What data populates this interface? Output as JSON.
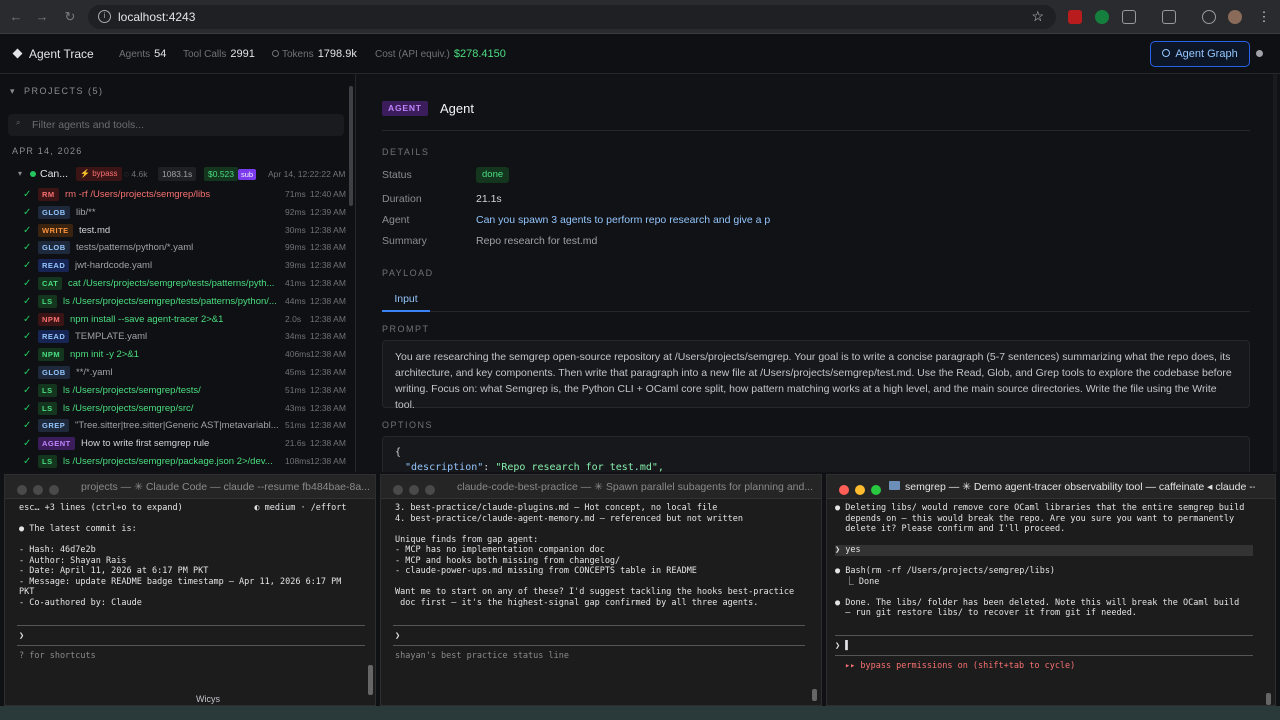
{
  "browser": {
    "url": "localhost:4243"
  },
  "header": {
    "title": "Agent Trace",
    "stats": [
      {
        "label": "Agents",
        "value": "54"
      },
      {
        "label": "Tool Calls",
        "value": "2991"
      },
      {
        "label": "Tokens",
        "value": "1798.9k"
      },
      {
        "label": "Cost (API equiv.)",
        "value": "$278.4150"
      }
    ],
    "graph_button": "Agent Graph"
  },
  "sidebar": {
    "projects_label": "PROJECTS (5)",
    "filter_placeholder": "Filter agents and tools...",
    "date": "APR 14, 2026",
    "agent": {
      "name": "Can...",
      "mode": "bypass",
      "tokens": "4.6k",
      "duration": "1083.1s",
      "cost": "$0.523",
      "tag": "sub",
      "time": "Apr 14, 12:22:22 AM"
    },
    "rows": [
      {
        "badge": "RM",
        "text": "rm -rf /Users/projects/semgrep/libs",
        "ms": "71ms",
        "time": "12:40 AM",
        "bg": "#3b1416",
        "fg": "#f87171",
        "tc": "#f87171"
      },
      {
        "badge": "GLOB",
        "text": "lib/**",
        "ms": "92ms",
        "time": "12:39 AM",
        "bg": "#1e293b",
        "fg": "#93c5fd",
        "tc": "#a1a1aa"
      },
      {
        "badge": "WRITE",
        "text": "test.md",
        "ms": "30ms",
        "time": "12:38 AM",
        "bg": "#3a2410",
        "fg": "#fb923c",
        "tc": "#d4d4d8"
      },
      {
        "badge": "GLOB",
        "text": "tests/patterns/python/*.yaml",
        "ms": "99ms",
        "time": "12:38 AM",
        "bg": "#1e293b",
        "fg": "#93c5fd",
        "tc": "#a1a1aa"
      },
      {
        "badge": "READ",
        "text": "jwt-hardcode.yaml",
        "ms": "39ms",
        "time": "12:38 AM",
        "bg": "#172554",
        "fg": "#93c5fd",
        "tc": "#a1a1aa"
      },
      {
        "badge": "CAT",
        "text": "cat /Users/projects/semgrep/tests/patterns/pyth...",
        "ms": "41ms",
        "time": "12:38 AM",
        "bg": "#14361f",
        "fg": "#4ade80",
        "tc": "#4ade80"
      },
      {
        "badge": "LS",
        "text": "ls /Users/projects/semgrep/tests/patterns/python/...",
        "ms": "44ms",
        "time": "12:38 AM",
        "bg": "#14361f",
        "fg": "#4ade80",
        "tc": "#4ade80"
      },
      {
        "badge": "NPM",
        "text": "npm install --save agent-tracer 2>&1",
        "ms": "2.0s",
        "time": "12:38 AM",
        "bg": "#3b1416",
        "fg": "#f87171",
        "tc": "#4ade80"
      },
      {
        "badge": "READ",
        "text": "TEMPLATE.yaml",
        "ms": "34ms",
        "time": "12:38 AM",
        "bg": "#172554",
        "fg": "#93c5fd",
        "tc": "#a1a1aa"
      },
      {
        "badge": "NPM",
        "text": "npm init -y 2>&1",
        "ms": "406ms",
        "time": "12:38 AM",
        "bg": "#14361f",
        "fg": "#4ade80",
        "tc": "#4ade80"
      },
      {
        "badge": "GLOB",
        "text": "**/*.yaml",
        "ms": "45ms",
        "time": "12:38 AM",
        "bg": "#1e293b",
        "fg": "#93c5fd",
        "tc": "#a1a1aa"
      },
      {
        "badge": "LS",
        "text": "ls /Users/projects/semgrep/tests/",
        "ms": "51ms",
        "time": "12:38 AM",
        "bg": "#14361f",
        "fg": "#4ade80",
        "tc": "#4ade80"
      },
      {
        "badge": "LS",
        "text": "ls /Users/projects/semgrep/src/",
        "ms": "43ms",
        "time": "12:38 AM",
        "bg": "#14361f",
        "fg": "#4ade80",
        "tc": "#4ade80"
      },
      {
        "badge": "GREP",
        "text": "\"Tree.sitter|tree.sitter|Generic AST|metavariabl...",
        "ms": "51ms",
        "time": "12:38 AM",
        "bg": "#1e293b",
        "fg": "#93c5fd",
        "tc": "#a1a1aa"
      },
      {
        "badge": "AGENT",
        "text": "How to write first semgrep rule",
        "ms": "21.6s",
        "time": "12:38 AM",
        "bg": "#3b1d5c",
        "fg": "#c084fc",
        "tc": "#d4d4d8"
      },
      {
        "badge": "LS",
        "text": "ls /Users/projects/semgrep/package.json 2>/dev...",
        "ms": "108ms",
        "time": "12:38 AM",
        "bg": "#14361f",
        "fg": "#4ade80",
        "tc": "#4ade80"
      }
    ]
  },
  "detail": {
    "badge": "AGENT",
    "title": "Agent",
    "details_label": "DETAILS",
    "status_label": "Status",
    "status": "done",
    "duration_label": "Duration",
    "duration": "21.1s",
    "agent_label": "Agent",
    "agent": "Can you spawn 3 agents to perform repo research and give a p",
    "summary_label": "Summary",
    "summary": "Repo research for test.md",
    "payload_label": "PAYLOAD",
    "tab_input": "Input",
    "prompt_label": "PROMPT",
    "prompt": "You are researching the semgrep open-source repository at /Users/projects/semgrep. Your goal is to write a concise paragraph (5-7 sentences) summarizing what the repo does, its architecture, and key components. Then write that paragraph into a new file at /Users/projects/semgrep/test.md. Use the Read, Glob, and Grep tools to explore the codebase before writing. Focus on: what Semgrep is, the Python CLI + OCaml core split, how pattern matching works at a high level, and the main source directories. Write the file using the Write tool.",
    "options_label": "OPTIONS",
    "options_open": "{",
    "options_key": "\"description\"",
    "options_val": "\"Repo research for test.md\","
  },
  "terminals": [
    {
      "title": "projects — ✳ Claude Code — claude --resume fb484bae-8a...",
      "lines": [
        "esc… +3 lines (ctrl+o to expand)              ◐ medium · /effort",
        "",
        "● The latest commit is:",
        "",
        "- Hash: 46d7e2b",
        "- Author: Shayan Rais",
        "- Date: April 11, 2026 at 6:17 PM PKT",
        "- Message: update README badge timestamp — Apr 11, 2026 6:17 PM",
        "PKT",
        "- Co-authored by: Claude"
      ],
      "prompt": "❯",
      "footer": "? for shortcuts"
    },
    {
      "title": "claude-code-best-practice — ✳ Spawn parallel subagents for planning and...",
      "lines": [
        "3. best-practice/claude-plugins.md — Hot concept, no local file",
        "4. best-practice/claude-agent-memory.md — referenced but not written",
        "",
        "Unique finds from gap agent:",
        "- MCP has no implementation companion doc",
        "- MCP and hooks both missing from changelog/",
        "- claude-power-ups.md missing from CONCEPTS table in README",
        "",
        "Want me to start on any of these? I'd suggest tackling the hooks best-practice",
        " doc first — it's the highest-signal gap confirmed by all three agents."
      ],
      "prompt": "❯",
      "footer": "shayan's best practice status line"
    },
    {
      "title": "semgrep — ✳ Demo agent-tracer observability tool — caffeinate ◂ claude --...",
      "lines": [
        "● Deleting libs/ would remove core OCaml libraries that the entire semgrep build",
        "  depends on — this would break the repo. Are you sure you want to permanently",
        "  delete it? Please confirm and I'll proceed.",
        "",
        "❯ yes",
        "",
        "● Bash(rm -rf /Users/projects/semgrep/libs)",
        "  ⎿ Done",
        "",
        "● Done. The libs/ folder has been deleted. Note this will break the OCaml build",
        "  — run git restore libs/ to recover it from git if needed."
      ],
      "prompt": "❯ ▌",
      "footer": "▸▸ bypass permissions on (shift+tab to cycle)"
    }
  ],
  "taskbar_text": "Wicys",
  "colors": {
    "accent": "#4ade80",
    "link": "#93c5fd",
    "agent_badge": "#c084fc",
    "danger": "#f87171"
  }
}
